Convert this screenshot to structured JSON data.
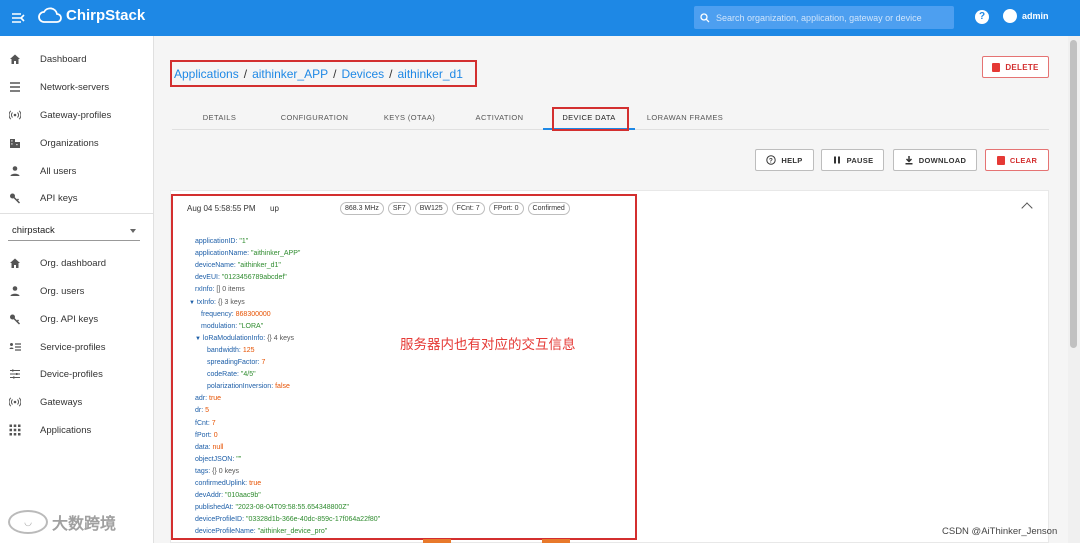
{
  "app": {
    "title": "ChirpStack",
    "search_placeholder": "Search organization, application, gateway or device",
    "help": "?",
    "user": "admin"
  },
  "sidebar": {
    "items": [
      {
        "label": "Dashboard",
        "icon": "home-icon"
      },
      {
        "label": "Network-servers",
        "icon": "list-icon"
      },
      {
        "label": "Gateway-profiles",
        "icon": "radio-tower-icon"
      },
      {
        "label": "Organizations",
        "icon": "building-icon"
      },
      {
        "label": "All users",
        "icon": "person-icon"
      },
      {
        "label": "API keys",
        "icon": "key-icon"
      }
    ],
    "org_select": "chirpstack",
    "org_items": [
      {
        "label": "Org. dashboard",
        "icon": "home-icon"
      },
      {
        "label": "Org. users",
        "icon": "person-icon"
      },
      {
        "label": "Org. API keys",
        "icon": "key-icon"
      },
      {
        "label": "Service-profiles",
        "icon": "service-profiles-icon"
      },
      {
        "label": "Device-profiles",
        "icon": "sliders-icon"
      },
      {
        "label": "Gateways",
        "icon": "radio-tower-icon"
      },
      {
        "label": "Applications",
        "icon": "apps-grid-icon"
      }
    ]
  },
  "breadcrumb": [
    "Applications",
    "aithinker_APP",
    "Devices",
    "aithinker_d1"
  ],
  "delete_label": "DELETE",
  "tabs": [
    "DETAILS",
    "CONFIGURATION",
    "KEYS (OTAA)",
    "ACTIVATION",
    "DEVICE DATA",
    "LORAWAN FRAMES"
  ],
  "active_tab": "DEVICE DATA",
  "actions": {
    "help": "HELP",
    "pause": "PAUSE",
    "download": "DOWNLOAD",
    "clear": "CLEAR"
  },
  "frame": {
    "time": "Aug 04 5:58:55 PM",
    "direction": "up",
    "chips": [
      "868.3 MHz",
      "SF7",
      "BW125",
      "FCnt: 7",
      "FPort: 0",
      "Confirmed"
    ]
  },
  "tree": [
    {
      "indent": 0,
      "key": "applicationID:",
      "value": "\"1\"",
      "type": "s"
    },
    {
      "indent": 0,
      "key": "applicationName:",
      "value": "\"aithinker_APP\"",
      "type": "s"
    },
    {
      "indent": 0,
      "key": "deviceName:",
      "value": "\"aithinker_d1\"",
      "type": "s"
    },
    {
      "indent": 0,
      "key": "devEUI:",
      "value": "\"0123456789abcdef\"",
      "type": "s"
    },
    {
      "indent": 0,
      "key": "rxInfo:",
      "value": "[]  0 items",
      "type": "meta"
    },
    {
      "indent": 0,
      "key": "txInfo:",
      "value": "{}  3 keys",
      "type": "meta",
      "toggle": "▼"
    },
    {
      "indent": 1,
      "key": "frequency:",
      "value": "868300000",
      "type": "n"
    },
    {
      "indent": 1,
      "key": "modulation:",
      "value": "\"LORA\"",
      "type": "s"
    },
    {
      "indent": 1,
      "key": "loRaModulationInfo:",
      "value": "{}  4 keys",
      "type": "meta",
      "toggle": "▼"
    },
    {
      "indent": 2,
      "key": "bandwidth:",
      "value": "125",
      "type": "n"
    },
    {
      "indent": 2,
      "key": "spreadingFactor:",
      "value": "7",
      "type": "n"
    },
    {
      "indent": 2,
      "key": "codeRate:",
      "value": "\"4/5\"",
      "type": "s"
    },
    {
      "indent": 2,
      "key": "polarizationInversion:",
      "value": "false",
      "type": "n"
    },
    {
      "indent": 0,
      "key": "adr:",
      "value": "true",
      "type": "n"
    },
    {
      "indent": 0,
      "key": "dr:",
      "value": "5",
      "type": "n"
    },
    {
      "indent": 0,
      "key": "fCnt:",
      "value": "7",
      "type": "n"
    },
    {
      "indent": 0,
      "key": "fPort:",
      "value": "0",
      "type": "n"
    },
    {
      "indent": 0,
      "key": "data:",
      "value": "null",
      "type": "n"
    },
    {
      "indent": 0,
      "key": "objectJSON:",
      "value": "\"\"",
      "type": "s"
    },
    {
      "indent": 0,
      "key": "tags:",
      "value": "{}  0 keys",
      "type": "meta"
    },
    {
      "indent": 0,
      "key": "confirmedUplink:",
      "value": "true",
      "type": "n"
    },
    {
      "indent": 0,
      "key": "devAddr:",
      "value": "\"010aac9b\"",
      "type": "s"
    },
    {
      "indent": 0,
      "key": "publishedAt:",
      "value": "\"2023-08-04T09:58:55.654348800Z\"",
      "type": "s"
    },
    {
      "indent": 0,
      "key": "deviceProfileID:",
      "value": "\"03328d1b-366e-40dc-859c-17f064a22f80\"",
      "type": "s"
    },
    {
      "indent": 0,
      "key": "deviceProfileName:",
      "value": "\"aithinker_device_pro\"",
      "type": "s"
    }
  ],
  "annotation": "服务器内也有对应的交互信息",
  "watermark": "大数跨境",
  "credit": "CSDN @AiThinker_Jenson"
}
